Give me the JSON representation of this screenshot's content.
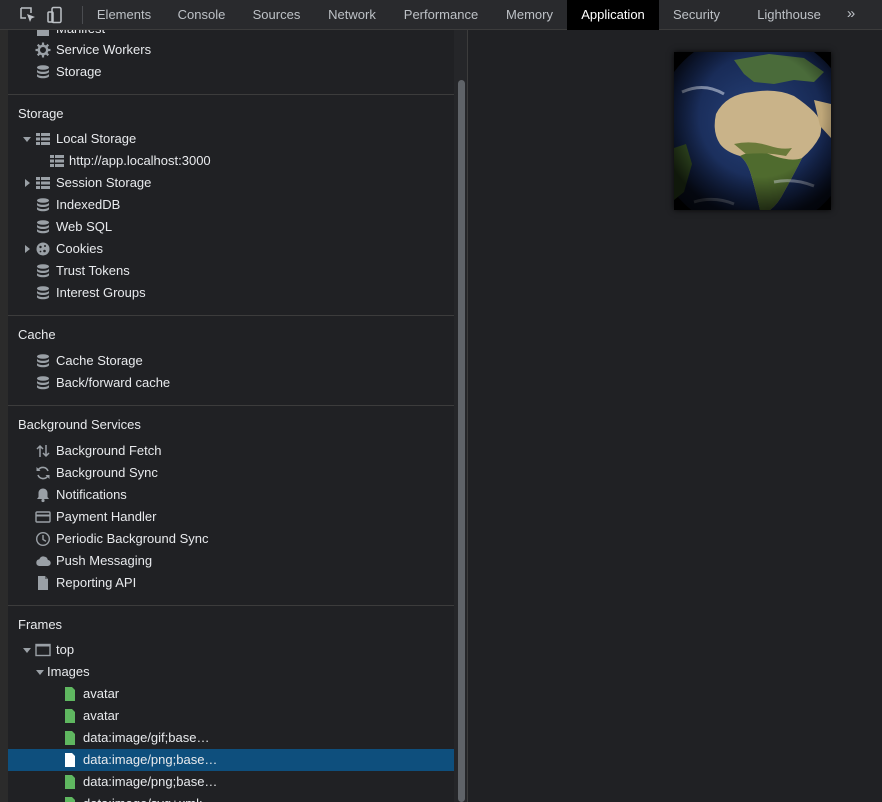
{
  "toolbar": {
    "tabs": [
      {
        "label": "Elements"
      },
      {
        "label": "Console"
      },
      {
        "label": "Sources"
      },
      {
        "label": "Network"
      },
      {
        "label": "Performance"
      },
      {
        "label": "Memory"
      },
      {
        "label": "Application",
        "active": true
      },
      {
        "label": "Security"
      },
      {
        "label": "Lighthouse"
      }
    ],
    "more": "»"
  },
  "sidebar": {
    "application": {
      "manifest": "Manifest",
      "service_workers": "Service Workers",
      "storage": "Storage"
    },
    "storage": {
      "title": "Storage",
      "local_storage": "Local Storage",
      "local_origin": "http://app.localhost:3000",
      "session_storage": "Session Storage",
      "indexeddb": "IndexedDB",
      "web_sql": "Web SQL",
      "cookies": "Cookies",
      "trust_tokens": "Trust Tokens",
      "interest_groups": "Interest Groups"
    },
    "cache": {
      "title": "Cache",
      "cache_storage": "Cache Storage",
      "bfcache": "Back/forward cache"
    },
    "background": {
      "title": "Background Services",
      "fetch": "Background Fetch",
      "sync": "Background Sync",
      "notifications": "Notifications",
      "payment": "Payment Handler",
      "periodic": "Periodic Background Sync",
      "push": "Push Messaging",
      "reporting": "Reporting API"
    },
    "frames": {
      "title": "Frames",
      "top": "top",
      "images": "Images",
      "files": [
        "avatar",
        "avatar",
        "data:image/gif;base…",
        "data:image/png;base…",
        "data:image/png;base…",
        "data:image/svg+xml;…"
      ],
      "selected_index": 3
    }
  },
  "colors": {
    "selected_row": "#0e4f7d",
    "file_icon": "#5fb760",
    "accent": "#8ab4f8"
  },
  "icons": {
    "inspect": "inspect-element-icon",
    "device": "device-toolbar-icon",
    "db": "database-icon",
    "grid": "table-grid-icon",
    "gear": "gear-icon",
    "cookie": "cookie-icon",
    "updown": "up-down-arrows-icon",
    "sync": "sync-icon",
    "bell": "bell-icon",
    "card": "credit-card-icon",
    "clock": "clock-icon",
    "cloud": "cloud-icon",
    "doc": "document-icon",
    "frame": "frame-icon"
  }
}
